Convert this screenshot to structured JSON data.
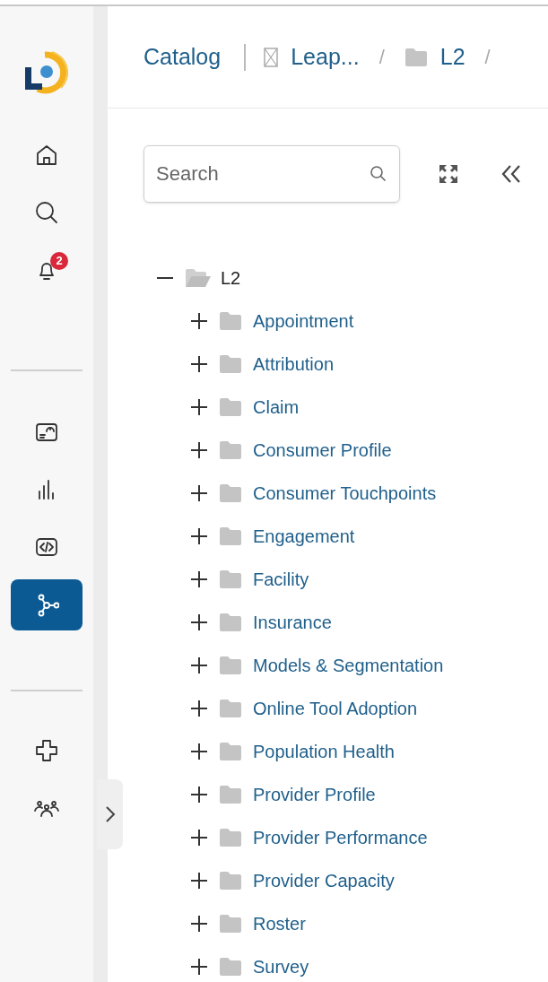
{
  "sidebar": {
    "groups": [
      [
        {
          "kind": "home",
          "selected": false
        },
        {
          "kind": "search",
          "selected": false
        },
        {
          "kind": "bell",
          "selected": false,
          "badge": "2"
        }
      ],
      [
        {
          "kind": "gauge",
          "selected": false
        },
        {
          "kind": "bars",
          "selected": false
        },
        {
          "kind": "code",
          "selected": false
        },
        {
          "kind": "nodes",
          "selected": true
        }
      ],
      [
        {
          "kind": "cross",
          "selected": false
        },
        {
          "kind": "people",
          "selected": false
        }
      ]
    ]
  },
  "breadcrumb": [
    {
      "kind": "link",
      "label": "Catalog"
    },
    {
      "kind": "db",
      "label": "Leap...",
      "separator": "/"
    },
    {
      "kind": "folder",
      "label": "L2",
      "separator": "/"
    }
  ],
  "search": {
    "placeholder": "Search"
  },
  "tree": [
    {
      "label": "L2",
      "expanded": true,
      "children": [
        {
          "label": "Appointment",
          "expanded": false
        },
        {
          "label": "Attribution",
          "expanded": false
        },
        {
          "label": "Claim",
          "expanded": false
        },
        {
          "label": "Consumer Profile",
          "expanded": false
        },
        {
          "label": "Consumer Touchpoints",
          "expanded": false
        },
        {
          "label": "Engagement",
          "expanded": false
        },
        {
          "label": "Facility",
          "expanded": false
        },
        {
          "label": "Insurance",
          "expanded": false
        },
        {
          "label": "Models & Segmentation",
          "expanded": false
        },
        {
          "label": "Online Tool Adoption",
          "expanded": false
        },
        {
          "label": "Population Health",
          "expanded": false
        },
        {
          "label": "Provider Profile",
          "expanded": false
        },
        {
          "label": "Provider Performance",
          "expanded": false
        },
        {
          "label": "Provider Capacity",
          "expanded": false
        },
        {
          "label": "Roster",
          "expanded": false
        },
        {
          "label": "Survey",
          "expanded": false
        }
      ]
    }
  ]
}
